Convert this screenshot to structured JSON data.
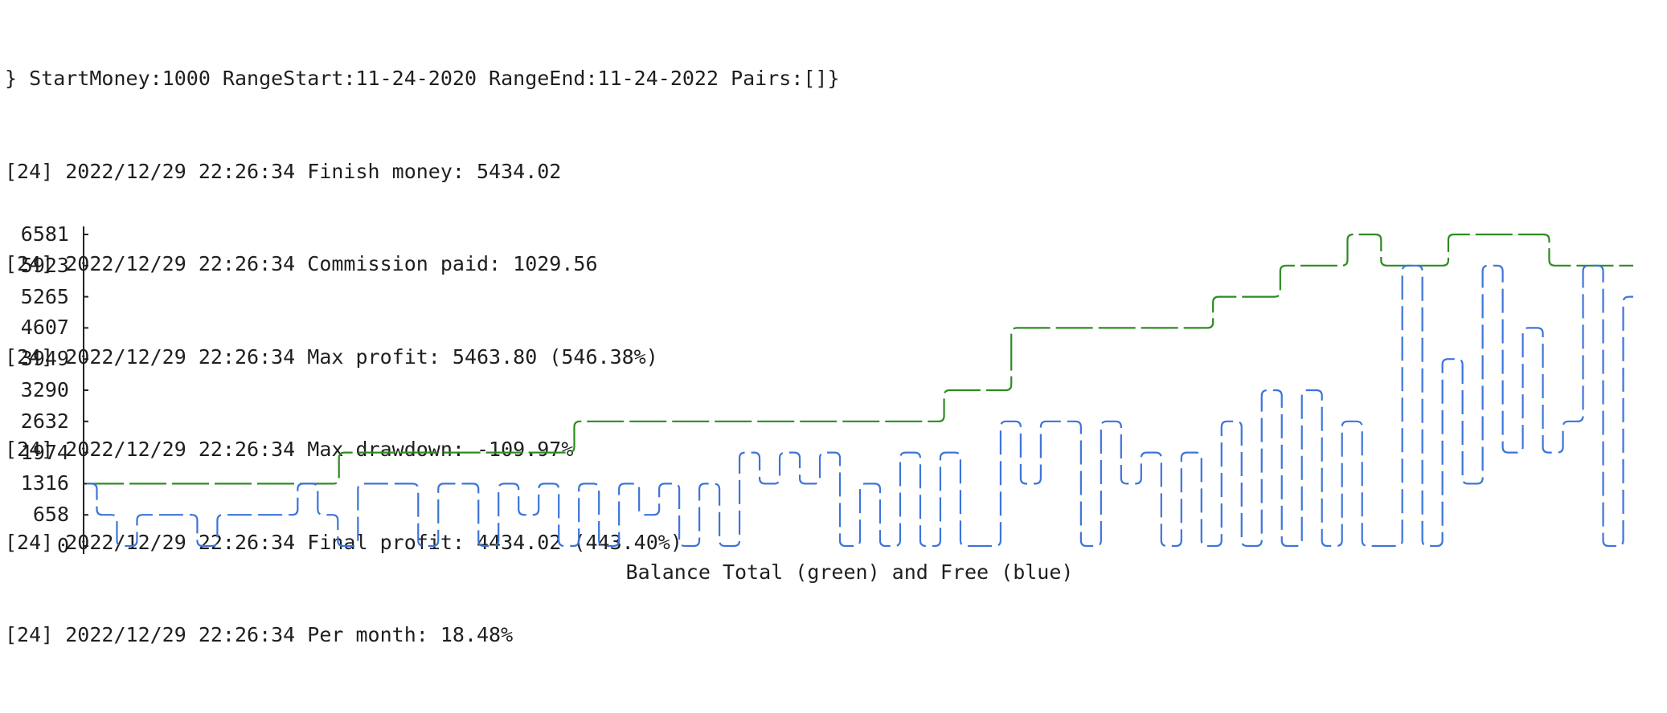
{
  "terminal": {
    "lines": [
      "} StartMoney:1000 RangeStart:11-24-2020 RangeEnd:11-24-2022 Pairs:[]}",
      "[24] 2022/12/29 22:26:34 Finish money: 5434.02",
      "[24] 2022/12/29 22:26:34 Commission paid: 1029.56",
      "[24] 2022/12/29 22:26:34 Max profit: 5463.80 (546.38%)",
      "[24] 2022/12/29 22:26:34 Max drawdown: -109.97%",
      "[24] 2022/12/29 22:26:34 Final profit: 4434.02 (443.40%)",
      "[24] 2022/12/29 22:26:34 Per month: 18.48%"
    ]
  },
  "chart_data": {
    "type": "line",
    "title": "Balance Total (green) and Free (blue)",
    "xlabel": "",
    "ylabel": "",
    "y_ticks": [
      "6581",
      "5923",
      "5265",
      "4607",
      "3949",
      "3290",
      "2632",
      "1974",
      "1316",
      "658",
      "0"
    ],
    "ylim": [
      0,
      6581
    ],
    "grid": false,
    "series": [
      {
        "name": "Total",
        "color": "#2e8b22",
        "values": [
          1316,
          1316,
          1316,
          1316,
          1316,
          1316,
          1316,
          1316,
          1974,
          1974,
          1974,
          1974,
          1974,
          1974,
          1974,
          2632,
          2632,
          2632,
          2632,
          2632,
          2632,
          2632,
          2632,
          2632,
          2632,
          2632,
          3290,
          3290,
          4607,
          4607,
          4607,
          4607,
          4607,
          4607,
          5265,
          5265,
          5923,
          5923,
          6581,
          5923,
          5923,
          6581,
          6581,
          6581,
          5923,
          5923,
          5923
        ]
      },
      {
        "name": "Free",
        "color": "#3d74d9",
        "values": [
          1316,
          658,
          0,
          658,
          658,
          658,
          0,
          658,
          658,
          658,
          658,
          1316,
          658,
          0,
          1316,
          1316,
          1316,
          0,
          1316,
          1316,
          0,
          1316,
          658,
          1316,
          0,
          1316,
          0,
          1316,
          658,
          1316,
          0,
          1316,
          0,
          1974,
          1316,
          1974,
          1316,
          1974,
          0,
          1316,
          0,
          1974,
          0,
          1974,
          0,
          0,
          2632,
          1316,
          2632,
          2632,
          0,
          2632,
          1316,
          1974,
          0,
          1974,
          0,
          2632,
          0,
          3290,
          0,
          3290,
          0,
          2632,
          0,
          0,
          5923,
          0,
          3949,
          1316,
          5923,
          1974,
          4607,
          1974,
          2632,
          5923,
          0,
          5265
        ]
      }
    ]
  }
}
